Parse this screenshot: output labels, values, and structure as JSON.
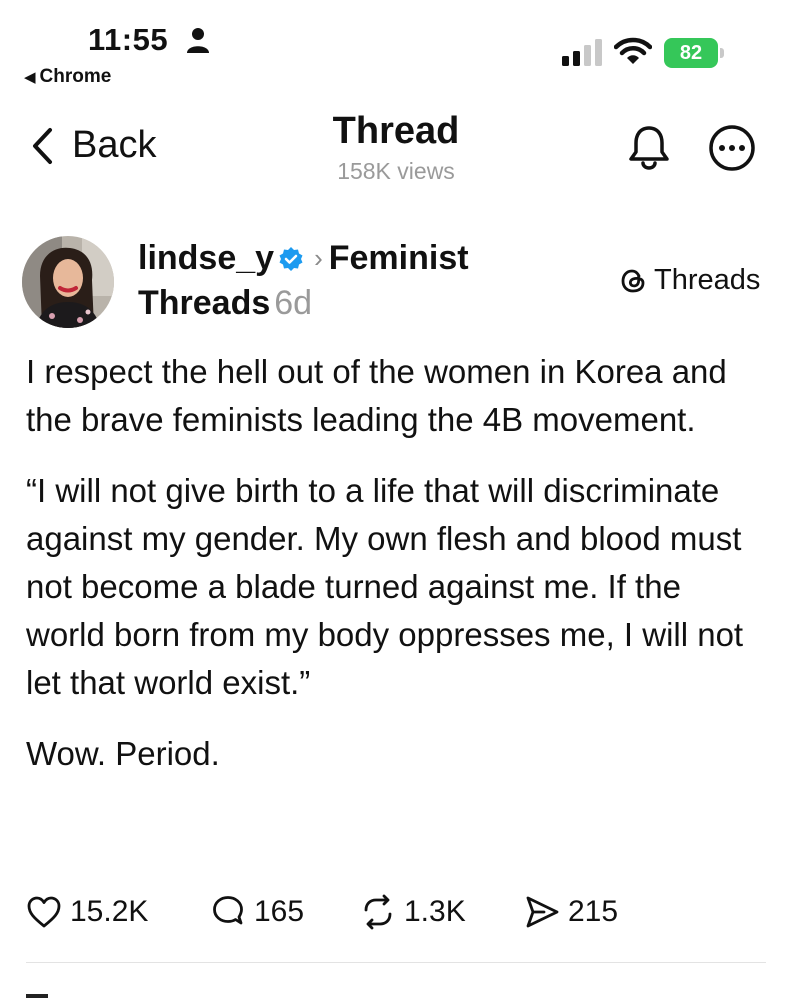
{
  "status_bar": {
    "time": "11:55",
    "back_app": "Chrome",
    "battery": "82",
    "battery_color": "#35c759"
  },
  "nav": {
    "back_label": "Back",
    "title": "Thread",
    "views": "158K views",
    "icons": [
      "chevron-left-icon",
      "bell-icon",
      "more-icon"
    ]
  },
  "post": {
    "author_handle": "lindse_y",
    "verified": true,
    "community": "Feminist Threads",
    "community_word1": "Feminist",
    "community_word2": "Threads",
    "age": "6d",
    "source_badge": "Threads",
    "paragraphs": [
      "I respect the hell out of the women in Korea and the brave feminists leading the 4B movement.",
      "“I will not give birth to a life that will discriminate against my gender. My own flesh and blood must not become a blade turned against me. If the world born from my body oppresses me, I will not let that world exist.”",
      "Wow. Period."
    ],
    "stats": {
      "likes": "15.2K",
      "replies": "165",
      "reposts": "1.3K",
      "shares": "215"
    },
    "accent_color": "#1d9bf0"
  }
}
